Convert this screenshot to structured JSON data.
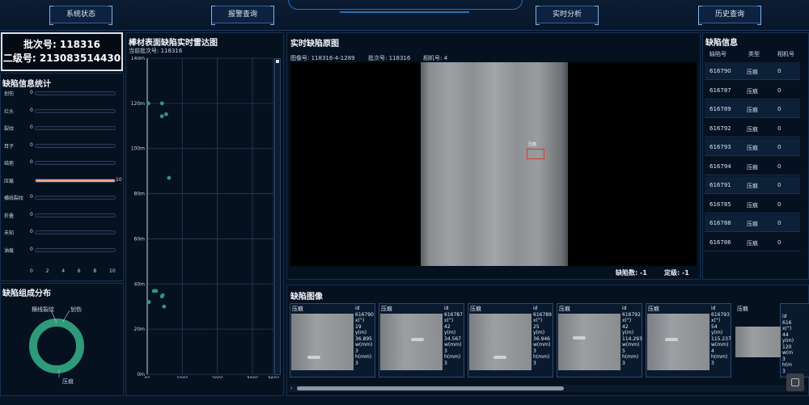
{
  "nav": {
    "system_status": "系统状态",
    "alarm_query": "报警查询",
    "realtime_analysis": "实时分析",
    "history_query": "历史查询"
  },
  "batch": {
    "batch_no": "批次号: 118316",
    "secondary_no": "二级号: 213083514430"
  },
  "defect_stats": {
    "title": "缺陷信息统计",
    "items": [
      {
        "label": "划伤",
        "value": "0",
        "fraction": 0
      },
      {
        "label": "烂头",
        "value": "0",
        "fraction": 0
      },
      {
        "label": "裂纹",
        "value": "0",
        "fraction": 0
      },
      {
        "label": "耳子",
        "value": "0",
        "fraction": 0
      },
      {
        "label": "结疤",
        "value": "0",
        "fraction": 0
      },
      {
        "label": "压痕",
        "value": "",
        "fraction": 1.0,
        "end": "10"
      },
      {
        "label": "横线裂纹",
        "value": "0",
        "fraction": 0
      },
      {
        "label": "折叠",
        "value": "0",
        "fraction": 0
      },
      {
        "label": "未知",
        "value": "0",
        "fraction": 0
      },
      {
        "label": "油痕",
        "value": "0",
        "fraction": 0
      }
    ],
    "axis": [
      "0",
      "2",
      "4",
      "6",
      "8",
      "10"
    ]
  },
  "composition": {
    "title": "缺陷组成分布",
    "labels": {
      "left": "横线裂纹",
      "right": "划伤",
      "bottom": "压痕"
    },
    "color": "#2e9a7a"
  },
  "radar": {
    "title": "棒材表面缺陷实时雷达图",
    "subtitle": "当前批次号: 118316",
    "y_ticks": [
      "140m",
      "120m",
      "100m",
      "80m",
      "60m",
      "40m",
      "20m",
      "0m"
    ],
    "x_ticks": [
      "0°",
      "100°",
      "200°",
      "300°",
      "360°"
    ]
  },
  "chart_data": {
    "type": "scatter",
    "title": "棒材表面缺陷实时雷达图",
    "xlim": [
      0,
      360
    ],
    "ylim": [
      0,
      140
    ],
    "points": [
      {
        "x": 3,
        "y": 120
      },
      {
        "x": 42,
        "y": 120
      },
      {
        "x": 42,
        "y": 114.3
      },
      {
        "x": 54,
        "y": 115.2
      },
      {
        "x": 62,
        "y": 87
      },
      {
        "x": 19,
        "y": 36.9
      },
      {
        "x": 25,
        "y": 36.9
      },
      {
        "x": 44,
        "y": 35
      },
      {
        "x": 42,
        "y": 34.5
      },
      {
        "x": 5,
        "y": 32
      },
      {
        "x": 48,
        "y": 30
      }
    ],
    "color": "#2e9a7a"
  },
  "realtime": {
    "title": "实时缺陷原图",
    "image_no": "图像号: 118316-4-1289",
    "batch_no": "批次号: 118316",
    "camera_no": "相机号: 4",
    "defect_tag": "压痕",
    "defect_count": "缺陷数: -1",
    "grade": "定级: -1"
  },
  "defect_info": {
    "title": "缺陷信息",
    "headers": [
      "缺陷号",
      "类型",
      "相机号"
    ],
    "rows": [
      [
        "616790",
        "压痕",
        "0"
      ],
      [
        "616787",
        "压痕",
        "0"
      ],
      [
        "616789",
        "压痕",
        "0"
      ],
      [
        "616792",
        "压痕",
        "0"
      ],
      [
        "616793",
        "压痕",
        "0"
      ],
      [
        "616794",
        "压痕",
        "0"
      ],
      [
        "616791",
        "压痕",
        "0"
      ],
      [
        "616785",
        "压痕",
        "0"
      ],
      [
        "616788",
        "压痕",
        "0"
      ],
      [
        "616786",
        "压痕",
        "0"
      ]
    ]
  },
  "defect_images": {
    "title": "缺陷图像",
    "cards": [
      {
        "type": "压痕",
        "lines": [
          "id",
          "616790",
          "x(°)",
          "19",
          "y(m)",
          "36.895",
          "w(mm)",
          "3",
          "h(mm)",
          "3"
        ]
      },
      {
        "type": "压痕",
        "lines": [
          "id",
          "616787",
          "x(°)",
          "42",
          "y(m)",
          "34.567",
          "w(mm)",
          "3",
          "h(mm)",
          "3"
        ]
      },
      {
        "type": "压痕",
        "lines": [
          "id",
          "616789",
          "x(°)",
          "25",
          "y(m)",
          "36.946",
          "w(mm)",
          "3",
          "h(mm)",
          "3"
        ]
      },
      {
        "type": "压痕",
        "lines": [
          "id",
          "616792",
          "x(°)",
          "42",
          "y(m)",
          "114.293",
          "w(mm)",
          "5",
          "h(mm)",
          "3"
        ]
      },
      {
        "type": "压痕",
        "lines": [
          "id",
          "616793",
          "x(°)",
          "54",
          "y(m)",
          "115.237",
          "w(mm)",
          "4",
          "h(mm)",
          "3"
        ]
      },
      {
        "type": "压痕",
        "lines": [
          "id",
          "616",
          "x(°)",
          "44",
          "y(m)",
          "120",
          "w(m",
          "3",
          "h(m",
          "3"
        ]
      }
    ]
  }
}
